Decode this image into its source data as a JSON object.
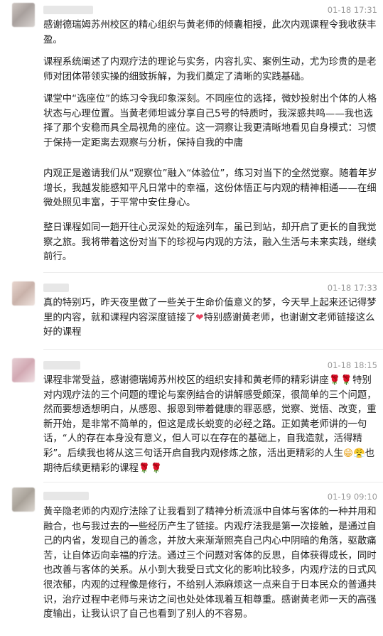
{
  "comments": [
    {
      "time": "01-18 17:31",
      "paragraphs": [
        "感谢德瑞姆苏州校区的精心组织与黄老师的倾囊相授，此次内观课程令我收获丰盈。",
        "课程系统阐述了内观疗法的理论与实务，内容扎实、案例生动，尤为珍贵的是老师对团体带领实操的细致拆解，为我们奠定了清晰的实践基础。",
        "课堂中“选座位”的练习令我印象深刻。不同座位的选择，微妙投射出个体的人格状态与心理位置。当黄老师坦诚分享自己5号的特质时，我深感共鸣——我也选择了那个安稳而具全局视角的座位。这一洞察让我更清晰地看见自身模式：习惯于保持一定距离去观察与分析，保持自我的中庸",
        "内观正是邀请我们从“观察位”融入“体验位”，练习对当下的全然觉察。随着年岁增长，我越发能感知平凡日常中的幸福，这份体悟正与内观的精神相通——在细微处照见丰富，于平常中安住身心。",
        "整日课程如同一趟开往心灵深处的短途列车，虽已到站，却开启了更长的自我觉察之旅。我将带着这份对当下的珍视与内观的方法，融入生活与未来实践，继续前行。"
      ]
    },
    {
      "time": "01-18 17:33",
      "text_a": "真的特别巧，昨天夜里做了一些关于生命价值意义的梦，今天早上起来还记得梦里的内容，就和课程内容深度链接了",
      "text_b": "特别感谢黄老师，也谢谢文老师链接这么好的课程",
      "emoji_heart": "heart-emoji"
    },
    {
      "time": "01-18 18:15",
      "text_a": "课程非常受益，感谢德瑞姆苏州校区的组织安排和黄老师的精彩讲座",
      "text_b": "特别对内观疗法的三个问题的理论与案例结合的讲解感受颇深，很简单的三个问题，然而要想透想明白，从感恩、报恩到带着健康的罪恶感，觉察、觉悟、改变，重新开始，是非常不简单的，但这是成长蜕变的必经之路。正如黄老师讲的一句话，“人的存在本身没有意义，但人可以在存在的基础上，自我造就，活得精彩”。后续我也将从这三句话开启自我内观修炼之旅，活出更精彩的人生",
      "text_c": "也期待后续更精彩的课程"
    },
    {
      "time": "01-19 09:10",
      "text": "黄辛隐老师的内观疗法除了让我看到了精神分析流派中自体与客体的一种并用和融合，也与我过去的一些经历产生了链接。内观疗法我是第一次接触，是通过自己的内省，发现自己的善念，并放大来渐渐照亮自己内心中阴暗的角落，驱散痛苦，让自体迈向幸福的疗法。通过三个问题对客体的反思，自体获得成长，同时也改善与客体的关系。从小到大我受日式文化的影响比较多，内观疗法的日式风很浓郁，内观的过程像是修行，不给别人添麻烦这一点来自于日本民众的普通共识，治疗过程中老师与来访之间也处处体现着互相尊重。感谢黄老师一天的高强度输出，让我认识了自己也看到了别人的不容易。"
    }
  ],
  "colors": {
    "time": "#9a9a9a",
    "heart": "#e8425f",
    "rose": "#d9262e"
  }
}
